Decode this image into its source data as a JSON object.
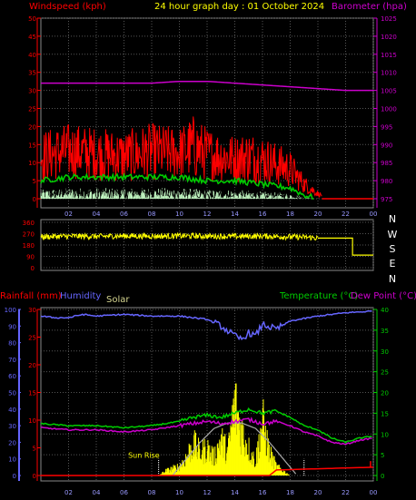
{
  "header": {
    "title": "24 hour graph day : 01 October 2024",
    "left_label": "Windspeed (kph)",
    "right_label": "Barometer (hpa)"
  },
  "labels": {
    "rainfall": "Rainfall (mm)",
    "humidity": "Humidity",
    "solar": "Solar",
    "temperature": "Temperature (°C)",
    "dew_point": "Dew Point (°C)",
    "sun_rise": "Sun Rise"
  },
  "colors": {
    "wind": "#ff0000",
    "wind_avg": "#00cc00",
    "wind_light": "#c8ffc8",
    "barometer": "#cc00cc",
    "direction": "#ffff00",
    "humidity": "#6666ff",
    "rain": "#ff0000",
    "temperature": "#00cc00",
    "dew_point": "#cc00cc",
    "solar": "#ffff00",
    "solar_theory": "#aaaaaa",
    "grid": "#555555"
  },
  "chart_data": [
    {
      "type": "line",
      "name": "wind-barometer",
      "x_ticks": [
        "02",
        "04",
        "06",
        "08",
        "10",
        "12",
        "14",
        "16",
        "18",
        "20",
        "22",
        "00"
      ],
      "y_left_ticks": [
        "0",
        "5",
        "10",
        "15",
        "20",
        "25",
        "30",
        "35",
        "40",
        "45",
        "50"
      ],
      "y_right_ticks": [
        "975",
        "980",
        "985",
        "990",
        "995",
        "1000",
        "1005",
        "1010",
        "1015",
        "1020",
        "1025"
      ],
      "xlim": [
        0,
        24
      ],
      "ylim_left": [
        0,
        50
      ],
      "ylim_right": [
        975,
        1025
      ],
      "series": [
        {
          "name": "Barometer (hpa)",
          "x": [
            0,
            2,
            4,
            6,
            8,
            10,
            12,
            14,
            16,
            18,
            20,
            22,
            24
          ],
          "values": [
            1007,
            1007,
            1007,
            1007,
            1007,
            1007.5,
            1007.5,
            1007,
            1006.5,
            1006,
            1005.5,
            1005,
            1005
          ]
        },
        {
          "name": "gust",
          "x": [
            0,
            2,
            4,
            6,
            8,
            10,
            11,
            12,
            14,
            15,
            16,
            17,
            18,
            19,
            20,
            21,
            24
          ],
          "values": [
            17,
            19,
            18,
            17,
            19,
            18,
            21,
            18,
            16,
            17,
            16,
            14,
            12,
            6,
            2,
            0,
            0
          ]
        },
        {
          "name": "wind",
          "x": [
            0,
            2,
            4,
            6,
            8,
            10,
            12,
            14,
            16,
            18,
            19,
            20,
            21,
            24
          ],
          "values": [
            9,
            11,
            10,
            9,
            10,
            11,
            10,
            9,
            8,
            6,
            3,
            1,
            0,
            0
          ]
        },
        {
          "name": "average",
          "x": [
            0,
            2,
            4,
            6,
            8,
            10,
            12,
            14,
            16,
            18,
            19,
            20
          ],
          "values": [
            5,
            6,
            6,
            6,
            6,
            6,
            5,
            5,
            4,
            3,
            1,
            0
          ]
        }
      ]
    },
    {
      "type": "scatter",
      "name": "wind-direction",
      "y_ticks": [
        "360",
        "270",
        "180",
        "90",
        "0"
      ],
      "y_right_ticks": [
        "N",
        "W",
        "S",
        "E",
        "N"
      ],
      "ylim": [
        0,
        360
      ],
      "series": [
        {
          "name": "direction",
          "x": [
            0,
            2,
            4,
            6,
            8,
            10,
            12,
            14,
            16,
            18,
            19.5,
            20,
            22,
            22.5,
            24
          ],
          "values": [
            245,
            250,
            248,
            252,
            250,
            252,
            250,
            248,
            250,
            245,
            240,
            235,
            235,
            100,
            100
          ]
        }
      ]
    },
    {
      "type": "area",
      "name": "rain-humidity-solar-temperature",
      "y_left_ticks": [
        "0",
        "5",
        "10",
        "15",
        "20",
        "25",
        "30"
      ],
      "y_humidity_ticks": [
        "0",
        "10",
        "20",
        "30",
        "40",
        "50",
        "60",
        "70",
        "80",
        "90",
        "100"
      ],
      "y_right_ticks": [
        "0",
        "5",
        "10",
        "15",
        "20",
        "25",
        "30",
        "35",
        "40"
      ],
      "ylim_rain": [
        0,
        30
      ],
      "ylim_humidity": [
        0,
        100
      ],
      "ylim_temperature": [
        0,
        40
      ],
      "series": [
        {
          "name": "Humidity",
          "x": [
            0,
            1,
            2,
            3,
            4,
            6,
            8,
            10,
            12,
            13,
            14,
            14.5,
            15,
            15.5,
            16,
            17,
            18,
            20,
            22,
            24
          ],
          "values": [
            96,
            95,
            95,
            97,
            96,
            97,
            96,
            96,
            94,
            90,
            84,
            82,
            86,
            84,
            91,
            88,
            93,
            96,
            98,
            99
          ]
        },
        {
          "name": "Temperature (°C)",
          "x": [
            0,
            2,
            4,
            6,
            8,
            10,
            11,
            12,
            13,
            14,
            15,
            16,
            17,
            18,
            19,
            20,
            21,
            22,
            23,
            24
          ],
          "values": [
            12.5,
            12,
            12,
            11.5,
            12,
            13,
            14,
            14.5,
            14,
            15,
            16,
            15,
            15.5,
            14,
            12,
            11,
            9,
            8,
            9,
            9.5
          ]
        },
        {
          "name": "Dew Point (°C)",
          "x": [
            0,
            2,
            4,
            6,
            8,
            10,
            11,
            12,
            13,
            14,
            15,
            16,
            17,
            18,
            19,
            20,
            21,
            22,
            23,
            24
          ],
          "values": [
            11.5,
            11,
            11,
            10.5,
            11,
            12,
            12.5,
            13,
            12.5,
            13,
            13.5,
            12.5,
            13,
            12,
            10.5,
            9.5,
            8,
            7.5,
            8.5,
            9
          ]
        },
        {
          "name": "Solar",
          "x": [
            8.5,
            9,
            10,
            10.5,
            11,
            11.5,
            12,
            12.5,
            13,
            13.5,
            14,
            14.3,
            14.6,
            15,
            15.5,
            16,
            16.5,
            17,
            17.5,
            18,
            19
          ],
          "values": [
            0,
            1,
            2,
            4,
            7,
            5,
            6,
            4,
            8,
            5,
            16,
            12,
            9,
            6,
            3,
            12,
            5,
            2,
            1,
            0,
            0
          ]
        },
        {
          "name": "theory",
          "x": [
            9.5,
            10.5,
            11.5,
            12.5,
            13.5,
            14.5,
            15.5,
            16.5,
            17.5,
            18.5
          ],
          "values": [
            0,
            3,
            6,
            8.5,
            9.5,
            9.5,
            8.5,
            6,
            3,
            0
          ]
        },
        {
          "name": "Rainfall (mm)",
          "x": [
            0,
            10,
            16.5,
            17,
            24
          ],
          "values": [
            0,
            0,
            0,
            1,
            1.5
          ]
        }
      ],
      "annotations": [
        "Sun Rise"
      ]
    }
  ]
}
